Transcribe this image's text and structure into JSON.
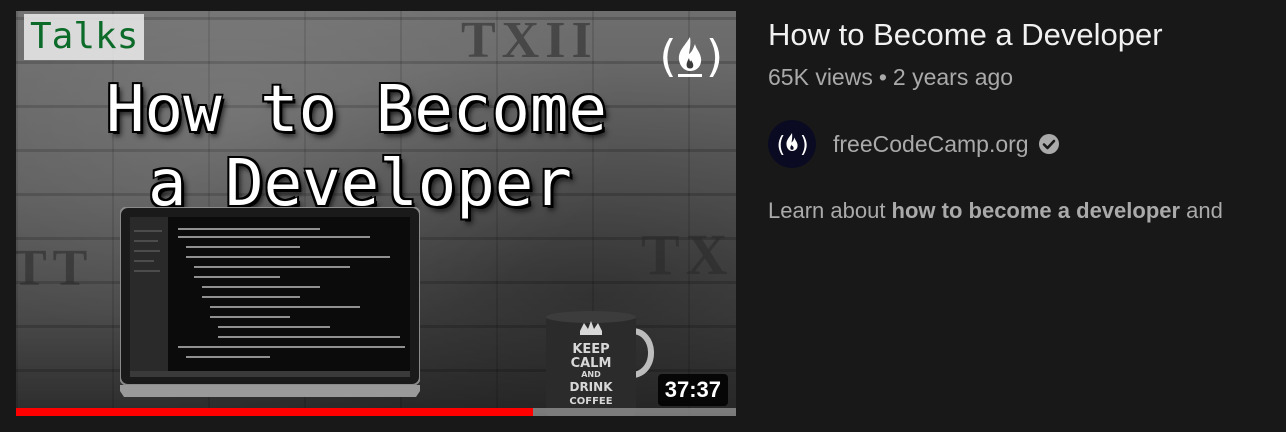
{
  "thumbnail": {
    "tag": "Talks",
    "title_line1": "How to Become",
    "title_line2": "a Developer",
    "wall_text_1": "TXII",
    "wall_text_2": "TX",
    "wall_text_3": "TT",
    "mug_text": [
      "KEEP",
      "CALM",
      "AND",
      "DRINK",
      "COFFEE"
    ],
    "duration": "37:37",
    "watch_progress_fraction": 0.718,
    "progress_color": "#ff0000"
  },
  "video": {
    "title": "How to Become a Developer",
    "views": "65K views",
    "separator": "•",
    "age": "2 years ago"
  },
  "channel": {
    "name": "freeCodeCamp.org",
    "avatar_icon": "fcc-flame-icon",
    "verified_icon": "verified-check-icon"
  },
  "description": {
    "prefix": "Learn about ",
    "bold": "how to become a developer",
    "suffix": " and"
  },
  "colors": {
    "background": "#181818",
    "title": "#f1f1f1",
    "secondary_text": "#aaaaaa",
    "avatar_bg": "#0a0a23"
  }
}
